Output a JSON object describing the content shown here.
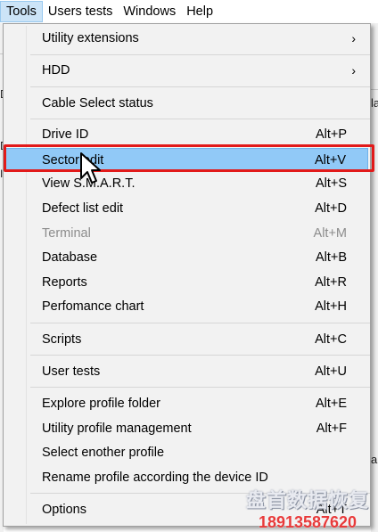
{
  "menubar": {
    "items": [
      {
        "label": "Tools"
      },
      {
        "label": "Users tests"
      },
      {
        "label": "Windows"
      },
      {
        "label": "Help"
      }
    ]
  },
  "background": {
    "chars": [
      "la",
      "D",
      "D",
      "ID",
      "a"
    ]
  },
  "menu": {
    "items": [
      {
        "label": "Utility extensions",
        "shortcut": "",
        "submenu": true
      },
      {
        "label": "HDD",
        "shortcut": "",
        "submenu": true
      },
      {
        "label": "Cable Select status",
        "shortcut": ""
      },
      {
        "label": "Drive ID",
        "shortcut": "Alt+P"
      },
      {
        "label": "Sector edit",
        "shortcut": "Alt+V",
        "selected": true
      },
      {
        "label": "View S.M.A.R.T.",
        "shortcut": "Alt+S"
      },
      {
        "label": "Defect list edit",
        "shortcut": "Alt+D"
      },
      {
        "label": "Terminal",
        "shortcut": "Alt+M",
        "disabled": true
      },
      {
        "label": "Database",
        "shortcut": "Alt+B"
      },
      {
        "label": "Reports",
        "shortcut": "Alt+R"
      },
      {
        "label": "Perfomance chart",
        "shortcut": "Alt+H"
      },
      {
        "label": "Scripts",
        "shortcut": "Alt+C"
      },
      {
        "label": "User tests",
        "shortcut": "Alt+U"
      },
      {
        "label": "Explore profile folder",
        "shortcut": "Alt+E"
      },
      {
        "label": "Utility profile management",
        "shortcut": "Alt+F"
      },
      {
        "label": "Select enother profile",
        "shortcut": ""
      },
      {
        "label": "Rename profile according the device ID",
        "shortcut": ""
      },
      {
        "label": "Options",
        "shortcut": "Alt+T"
      }
    ],
    "submenu_arrow": "›"
  },
  "watermark": {
    "line1": "盘首数据恢复",
    "line2": "18913587620"
  },
  "colors": {
    "selection": "#91c9f7",
    "annotation_box": "#e21a1a",
    "menubar_active": "#cce4f7"
  }
}
